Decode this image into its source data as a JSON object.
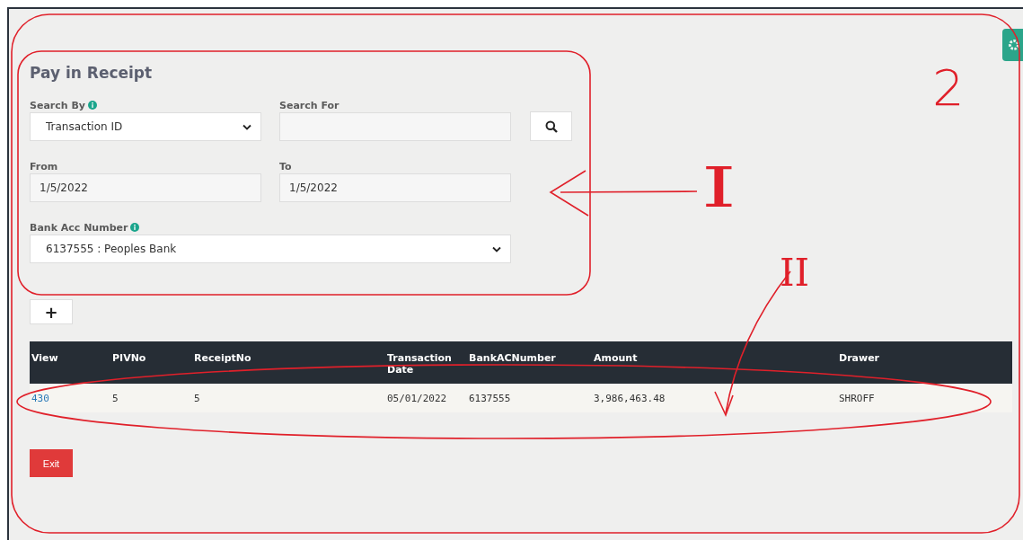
{
  "form": {
    "title": "Pay in Receipt",
    "search_by": {
      "label": "Search By",
      "value": "Transaction ID"
    },
    "search_for": {
      "label": "Search For"
    },
    "from": {
      "label": "From",
      "value": "1/5/2022"
    },
    "to": {
      "label": "To",
      "value": "1/5/2022"
    },
    "bank_acc": {
      "label": "Bank Acc Number",
      "value": "6137555 : Peoples Bank"
    },
    "add_button": "+"
  },
  "table": {
    "columns": [
      "View",
      "PIVNo",
      "ReceiptNo",
      "Transaction Date",
      "BankACNumber",
      "Amount",
      "Drawer"
    ],
    "rows": [
      [
        "430",
        "5",
        "5",
        "05/01/2022",
        "6137555",
        "3,986,463.48",
        "SHROFF"
      ]
    ]
  },
  "exit_button": "Exit",
  "annotations": [
    "I",
    "II",
    "2"
  ]
}
